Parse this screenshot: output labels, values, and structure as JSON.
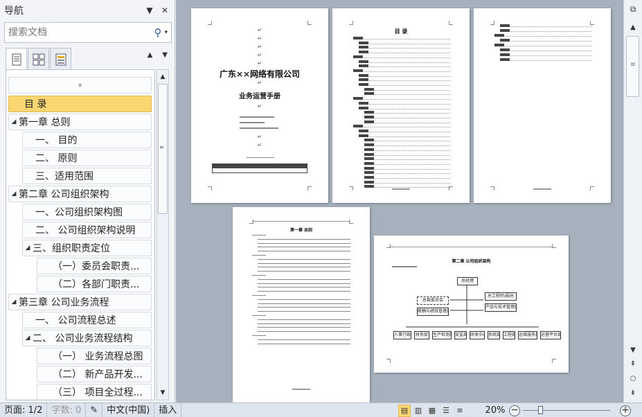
{
  "nav": {
    "title": "导航",
    "search_placeholder": "搜索文档",
    "items": [
      {
        "label": "目 录",
        "level": 0,
        "selected": true
      },
      {
        "label": "第一章 总则",
        "level": 0,
        "expanded": true
      },
      {
        "label": "一、 目的",
        "level": 1
      },
      {
        "label": "二、 原则",
        "level": 1
      },
      {
        "label": "三、适用范围",
        "level": 1
      },
      {
        "label": "第二章 公司组织架构",
        "level": 0,
        "expanded": true
      },
      {
        "label": "一、公司组织架构图",
        "level": 1
      },
      {
        "label": "二、 公司组织架构说明",
        "level": 1
      },
      {
        "label": "三、组织职责定位",
        "level": 1,
        "expanded": true
      },
      {
        "label": "（一）委员会职责...",
        "level": 2
      },
      {
        "label": "（二）各部门职责...",
        "level": 2
      },
      {
        "label": "第三章 公司业务流程",
        "level": 0,
        "expanded": true
      },
      {
        "label": "一、 公司流程总述",
        "level": 1
      },
      {
        "label": "二、 公司业务流程结构",
        "level": 1,
        "expanded": true
      },
      {
        "label": "（一） 业务流程总图",
        "level": 2
      },
      {
        "label": "（二） 新产品开发...",
        "level": 2
      },
      {
        "label": "（三） 项目全过程...",
        "level": 2
      }
    ]
  },
  "status": {
    "page": "页面: 1/2",
    "words": "字数: 0",
    "language": "中文(中国)",
    "mode": "插入",
    "zoom": "20%"
  },
  "document": {
    "cover_title": "广东××网络有限公司",
    "cover_subtitle": "业务运营手册",
    "toc_title": "目  录",
    "ch1_title": "第一章 总则",
    "ch2_title": "第二章 公司组织架构",
    "org_top": "总经理",
    "org_left1": "总裁委员会",
    "org_left2": "薪酬与绩效管理委员会",
    "org_right1": "总工程师/副总",
    "org_right2": "产品与技术管理委员会",
    "org_depts": [
      "人事行政部",
      "财务部",
      "生产检测部",
      "安监部",
      "研发中心",
      "系统部",
      "工程部",
      "运维服务部",
      "运营平台部"
    ]
  }
}
